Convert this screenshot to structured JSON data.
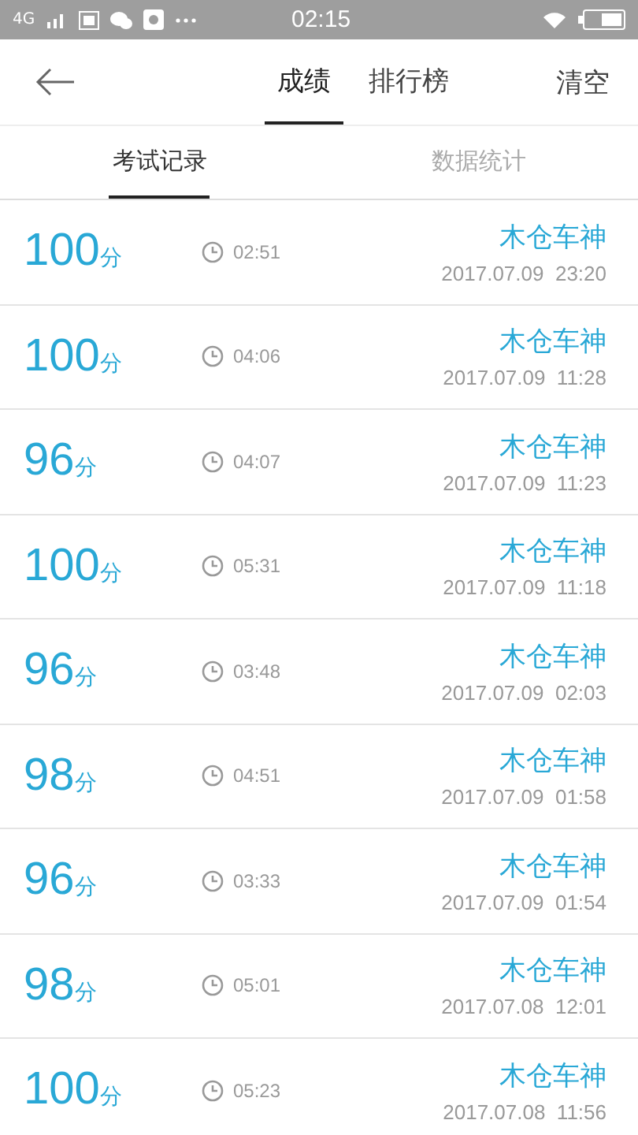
{
  "status_bar": {
    "network": "4G",
    "time": "02:15"
  },
  "header": {
    "tabs": [
      {
        "label": "成绩",
        "selected": true
      },
      {
        "label": "排行榜",
        "selected": false
      }
    ],
    "action": "清空"
  },
  "subtabs": [
    {
      "label": "考试记录",
      "selected": true
    },
    {
      "label": "数据统计",
      "selected": false
    }
  ],
  "records": [
    {
      "score": "100",
      "unit": "分",
      "duration": "02:51",
      "name": "木仓车神",
      "date": "2017.07.09  23:20"
    },
    {
      "score": "100",
      "unit": "分",
      "duration": "04:06",
      "name": "木仓车神",
      "date": "2017.07.09  11:28"
    },
    {
      "score": "96",
      "unit": "分",
      "duration": "04:07",
      "name": "木仓车神",
      "date": "2017.07.09  11:23"
    },
    {
      "score": "100",
      "unit": "分",
      "duration": "05:31",
      "name": "木仓车神",
      "date": "2017.07.09  11:18"
    },
    {
      "score": "96",
      "unit": "分",
      "duration": "03:48",
      "name": "木仓车神",
      "date": "2017.07.09  02:03"
    },
    {
      "score": "98",
      "unit": "分",
      "duration": "04:51",
      "name": "木仓车神",
      "date": "2017.07.09  01:58"
    },
    {
      "score": "96",
      "unit": "分",
      "duration": "03:33",
      "name": "木仓车神",
      "date": "2017.07.09  01:54"
    },
    {
      "score": "98",
      "unit": "分",
      "duration": "05:01",
      "name": "木仓车神",
      "date": "2017.07.08  12:01"
    },
    {
      "score": "100",
      "unit": "分",
      "duration": "05:23",
      "name": "木仓车神",
      "date": "2017.07.08  11:56"
    }
  ]
}
